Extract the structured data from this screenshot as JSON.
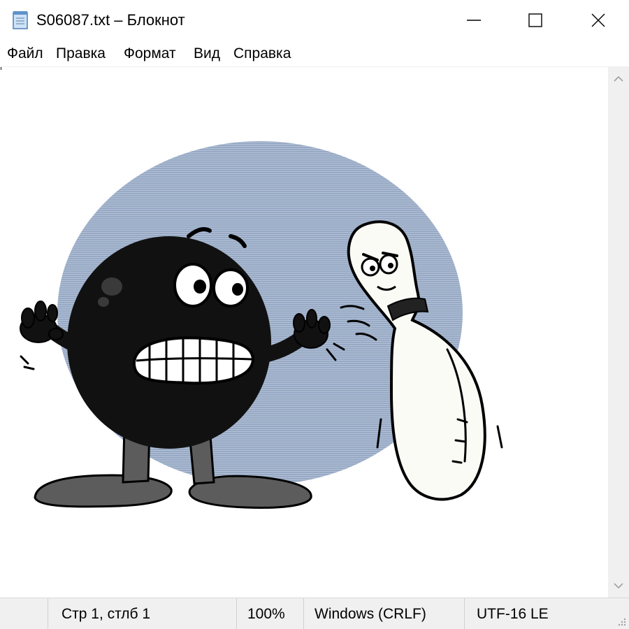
{
  "window": {
    "title": "S06087.txt – Блокнот",
    "icons": {
      "app": "notepad-icon",
      "minimize": "minimize-icon",
      "maximize": "maximize-icon",
      "close": "close-icon"
    }
  },
  "menu": {
    "items": [
      {
        "label": "Файл"
      },
      {
        "label": "Правка"
      },
      {
        "label": "Формат"
      },
      {
        "label": "Вид"
      },
      {
        "label": "Справка"
      }
    ]
  },
  "editor": {
    "content_image": "bowling-ball-and-pin-cartoon",
    "colors": {
      "backdrop": "#97a9c4",
      "ball": "#111111",
      "pin": "#fbfbf6",
      "shoes": "#5c5c5c"
    }
  },
  "status": {
    "position": "Стр 1, стлб 1",
    "zoom": "100%",
    "line_endings": "Windows (CRLF)",
    "encoding": "UTF-16 LE"
  }
}
